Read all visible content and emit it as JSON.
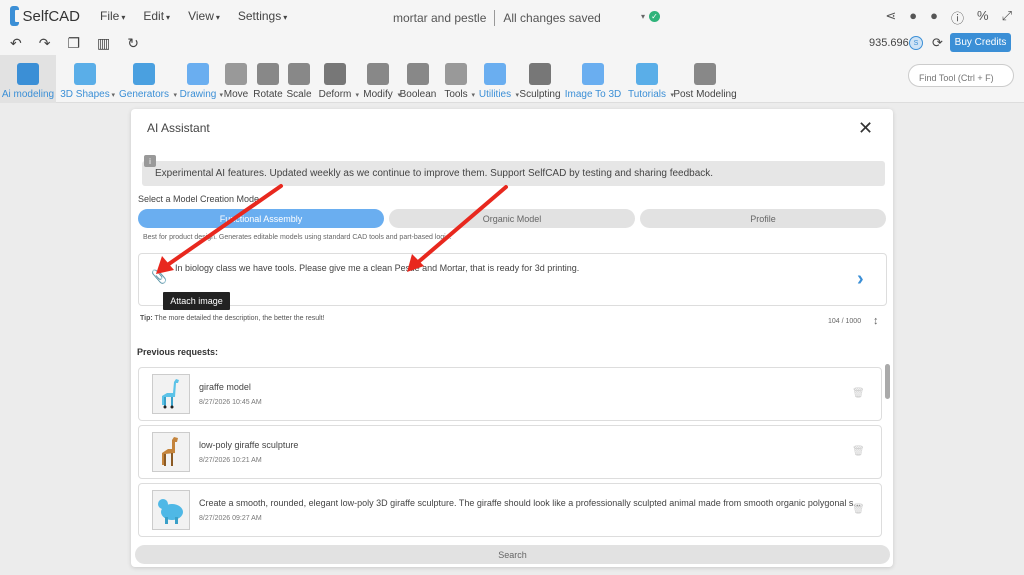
{
  "app": {
    "name": "SelfCAD"
  },
  "menu": [
    {
      "label": "File"
    },
    {
      "label": "Edit"
    },
    {
      "label": "View"
    },
    {
      "label": "Settings"
    }
  ],
  "document": {
    "name": "mortar and pestle",
    "status": "All changes saved"
  },
  "account": {
    "credits": "935.696",
    "buy_label": "Buy Credits"
  },
  "toolbar": {
    "tools": [
      {
        "label": "Ai modeling",
        "icon": "ai-modeling-icon",
        "accent": true,
        "active": true
      },
      {
        "label": "3D Shapes",
        "icon": "cube-icon",
        "accent": true,
        "dropdown": true
      },
      {
        "label": "Generators",
        "icon": "generator-icon",
        "accent": true,
        "dropdown": true
      },
      {
        "label": "Drawing",
        "icon": "drawing-icon",
        "accent": true,
        "dropdown": true
      },
      {
        "label": "Move",
        "icon": "move-icon"
      },
      {
        "label": "Rotate",
        "icon": "rotate-icon"
      },
      {
        "label": "Scale",
        "icon": "scale-icon"
      },
      {
        "label": "Deform",
        "icon": "deform-icon",
        "dropdown": true
      },
      {
        "label": "Modify",
        "icon": "modify-icon",
        "dropdown": true
      },
      {
        "label": "Boolean",
        "icon": "boolean-icon"
      },
      {
        "label": "Tools",
        "icon": "tools-icon",
        "dropdown": true
      },
      {
        "label": "Utilities",
        "icon": "utilities-icon",
        "accent": true,
        "dropdown": true
      },
      {
        "label": "Sculpting",
        "icon": "sculpting-icon"
      },
      {
        "label": "Image To 3D",
        "icon": "image-to-3d-icon",
        "accent": true
      },
      {
        "label": "Tutorials",
        "icon": "tutorials-icon",
        "accent": true,
        "dropdown": true
      },
      {
        "label": "Post Modeling",
        "icon": "post-modeling-icon"
      }
    ],
    "find_placeholder": "Find Tool (Ctrl + F)"
  },
  "dialog": {
    "title": "AI Assistant",
    "notice": "Experimental AI features. Updated weekly as we continue to improve them. Support SelfCAD by testing and sharing feedback.",
    "mode_label": "Select a Model Creation Mode",
    "modes": [
      {
        "label": "Functional Assembly",
        "selected": true
      },
      {
        "label": "Organic Model",
        "selected": false
      },
      {
        "label": "Profile",
        "selected": false
      }
    ],
    "mode_description": "Best for product design. Generates editable models using standard CAD tools and part-based logic.",
    "prompt": "In biology class we have tools. Please give me a clean Pestle and Mortar, that is ready for 3d printing.",
    "attach_tooltip": "Attach image",
    "tip_label": "Tip:",
    "tip_text": "The more detailed the description, the better the result!",
    "char_count": "104 / 1000",
    "previous_label": "Previous requests:",
    "requests": [
      {
        "title": "giraffe model",
        "date": "8/27/2026 10:45 AM"
      },
      {
        "title": "low-poly giraffe sculpture",
        "date": "8/27/2026 10:21 AM"
      },
      {
        "title": "Create a smooth, rounded, elegant low-poly 3D giraffe sculpture. The giraffe should look like a professionally sculpted animal made from smooth organic polygonal s...",
        "date": "8/27/2026 09:27 AM"
      }
    ],
    "search_label": "Search"
  },
  "colors": {
    "accent": "#3b8fd6",
    "selected_mode": "#6aaef0",
    "annotation_arrow": "#e8281e"
  }
}
